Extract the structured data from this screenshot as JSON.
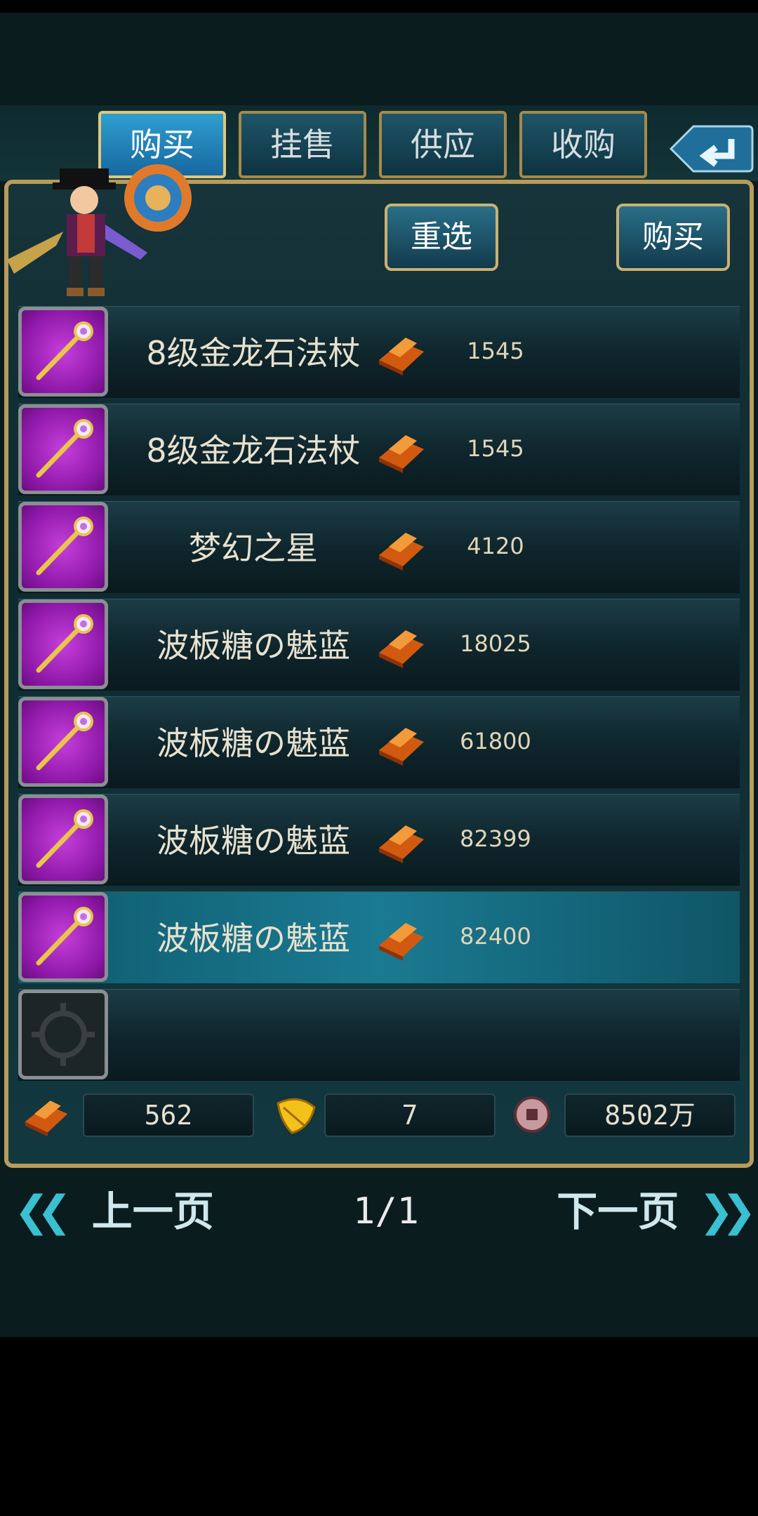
{
  "tabs": [
    "购买",
    "挂售",
    "供应",
    "收购"
  ],
  "actions": {
    "reselect": "重选",
    "buy": "购买"
  },
  "items": [
    {
      "name": "8级金龙石法杖",
      "price": "1545",
      "icon": "staff-icon"
    },
    {
      "name": "8级金龙石法杖",
      "price": "1545",
      "icon": "staff-icon"
    },
    {
      "name": "梦幻之星",
      "price": "4120",
      "icon": "staff-icon"
    },
    {
      "name": "波板糖の魅蓝",
      "price": "18025",
      "icon": "staff-icon"
    },
    {
      "name": "波板糖の魅蓝",
      "price": "61800",
      "icon": "staff-icon"
    },
    {
      "name": "波板糖の魅蓝",
      "price": "82399",
      "icon": "staff-icon"
    },
    {
      "name": "波板糖の魅蓝",
      "price": "82400",
      "icon": "staff-icon"
    }
  ],
  "currency": {
    "gold": "562",
    "leaf": "7",
    "coin": "8502万"
  },
  "pager": {
    "prev": "上一页",
    "next": "下一页",
    "page": "1/1"
  },
  "colors": {
    "accent": "#b79c5c",
    "selected_row": "#1a7a92",
    "slot_purple": "#a828c0"
  }
}
